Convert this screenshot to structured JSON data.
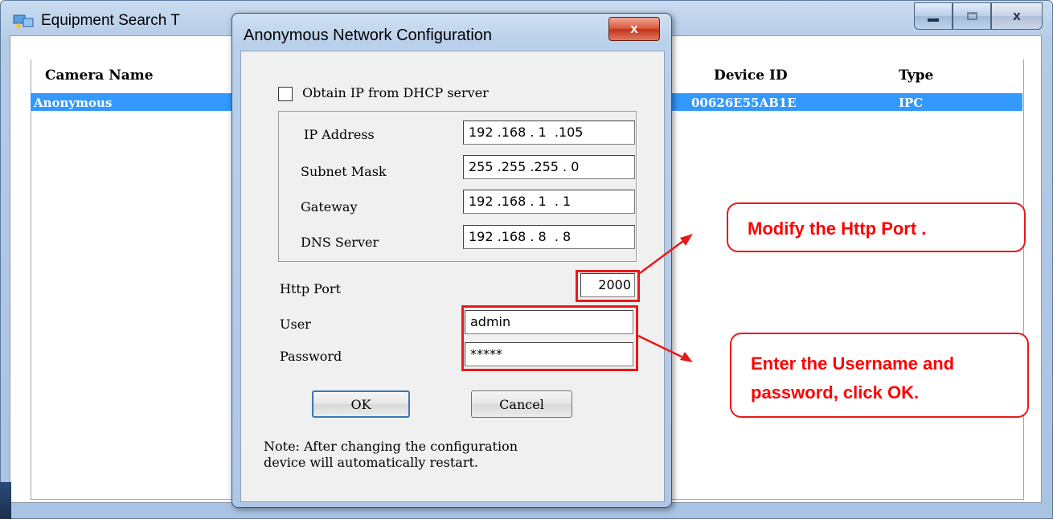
{
  "main_window": {
    "title": "Equipment Search T",
    "icon": "network-search-icon",
    "minimize_icon": "minimize-icon",
    "maximize_icon": "maximize-icon",
    "close_label": "x",
    "columns": {
      "camera_name": "Camera Name",
      "device_id": "Device ID",
      "type": "Type"
    },
    "rows": [
      {
        "camera_name": "Anonymous",
        "device_id": "00626E55AB1E",
        "type": "IPC"
      }
    ]
  },
  "dialog": {
    "title": "Anonymous Network Configuration",
    "close_label": "x",
    "dhcp_label": "Obtain IP from DHCP server",
    "dhcp_checked": false,
    "fields": {
      "ip_address": {
        "label": "IP Address",
        "value": "192 .168 . 1  .105"
      },
      "subnet_mask": {
        "label": "Subnet Mask",
        "value": "255 .255 .255 . 0"
      },
      "gateway": {
        "label": "Gateway",
        "value": "192 .168 . 1  . 1"
      },
      "dns_server": {
        "label": "DNS Server",
        "value": "192 .168 . 8  . 8"
      }
    },
    "http_port": {
      "label": "Http Port",
      "value": "2000"
    },
    "user": {
      "label": "User",
      "value": "admin"
    },
    "password": {
      "label": "Password",
      "value": "*****"
    },
    "ok_label": "OK",
    "cancel_label": "Cancel",
    "note_line1": "Note: After changing the configuration",
    "note_line2": "device will automatically restart."
  },
  "annotations": {
    "color": "#e81919",
    "callout1": "Modify the Http Port .",
    "callout2_line1": "Enter the Username and",
    "callout2_line2": "password, click OK."
  },
  "colors": {
    "selection": "#3399ff",
    "window_frame": "#b4cbe6",
    "close_red": "#c0321a"
  }
}
